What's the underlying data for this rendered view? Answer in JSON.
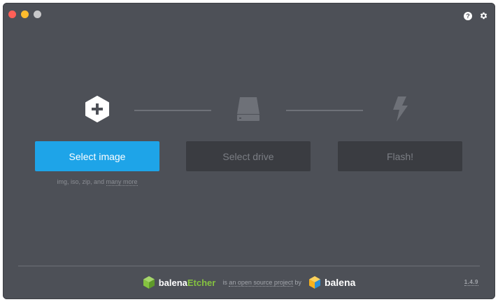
{
  "window": {
    "background": "#4d5057",
    "traffic_lights": [
      "#ff5f57",
      "#febc2e",
      "#c8c8ca"
    ]
  },
  "toolbar": {
    "help_icon": "help-icon",
    "help_glyph": "?",
    "settings_icon": "gear-icon"
  },
  "steps": [
    {
      "icon": "plus-hexagon-icon",
      "label": "Select image",
      "state": "active"
    },
    {
      "icon": "drive-icon",
      "label": "Select drive",
      "state": "disabled"
    },
    {
      "icon": "lightning-icon",
      "label": "Flash!",
      "state": "disabled"
    }
  ],
  "hint": {
    "text": "img, iso, zip, and ",
    "link": "many more"
  },
  "footer": {
    "brand_prefix": "balena",
    "brand_accent": "Etcher",
    "tagline_before": "is ",
    "tagline_link": "an open source project",
    "tagline_after": " by",
    "company": "balena",
    "version": "1.4.9"
  },
  "colors": {
    "primary": "#1ea4e8",
    "disabled_bg": "#3a3c41",
    "disabled_text": "#7b7e84",
    "accent_green": "#85c340",
    "balena_yellow": "#f8b21c"
  }
}
